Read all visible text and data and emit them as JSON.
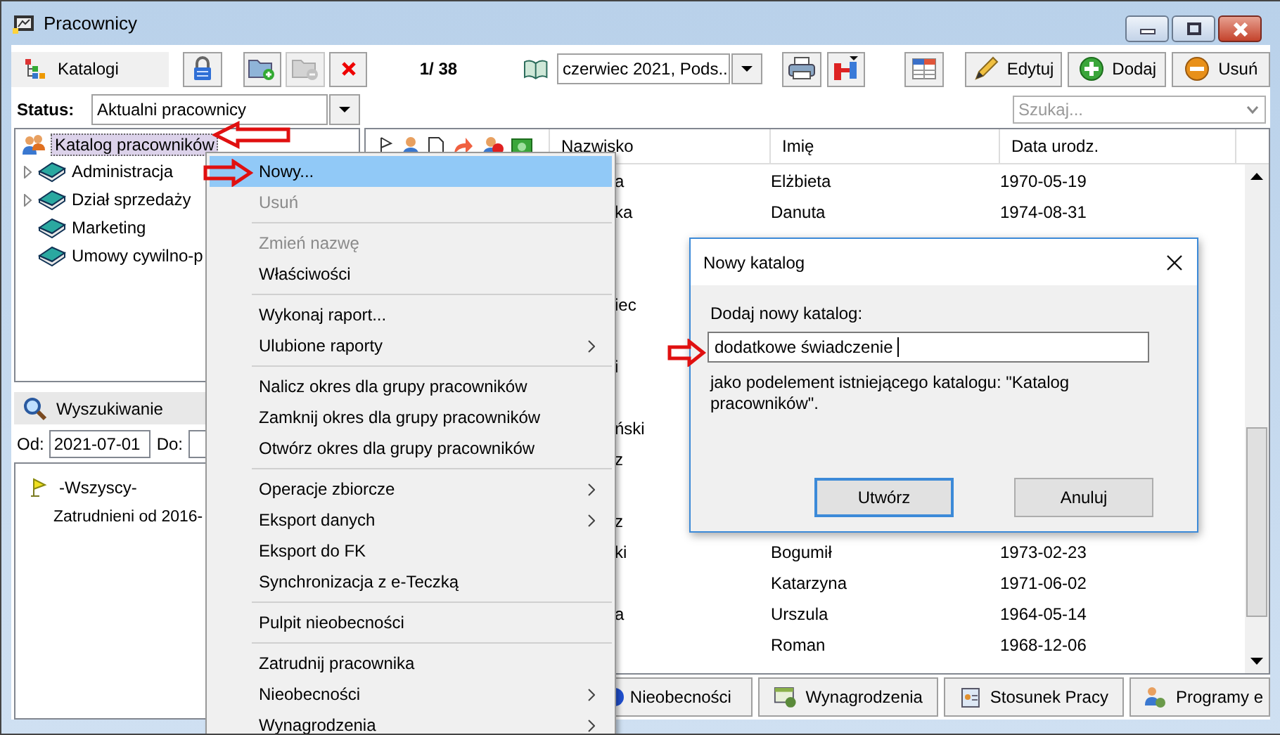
{
  "window": {
    "title": "Pracownicy"
  },
  "toolbar": {
    "catalogs_button": "Katalogi",
    "tool_buttons": [
      {
        "kind": "lock",
        "disabled": false
      },
      {
        "kind": "folder-add",
        "disabled": false
      },
      {
        "kind": "folder-remove",
        "disabled": true
      },
      {
        "kind": "delete",
        "disabled": false
      }
    ],
    "record_counter": "1/ 38",
    "period": "czerwiec 2021, Pods...",
    "actions": [
      {
        "label": "Edytuj",
        "kind": "edit"
      },
      {
        "label": "Dodaj",
        "kind": "add"
      },
      {
        "label": "Usuń",
        "kind": "remove"
      }
    ]
  },
  "status": {
    "label": "Status:",
    "value": "Aktualni pracownicy"
  },
  "search": {
    "placeholder": "Szukaj..."
  },
  "catalog_tree": {
    "root": {
      "label": "Katalog pracowników",
      "selected": true
    },
    "items": [
      {
        "label": "Administracja",
        "expandable": true
      },
      {
        "label": "Dział sprzedaży",
        "expandable": true
      },
      {
        "label": "Marketing",
        "expandable": false
      },
      {
        "label": "Umowy cywilno-p",
        "expandable": false
      }
    ]
  },
  "search_panel": {
    "title": "Wyszukiwanie",
    "from_label": "Od:",
    "from": "2021-07-01",
    "to_label": "Do:",
    "items": [
      {
        "label": "-Wszyscy-",
        "kind": "flag"
      },
      {
        "label": "Zatrudnieni od 2016-",
        "kind": "plain"
      }
    ]
  },
  "table": {
    "columns": [
      "Nazwisko",
      "Imię",
      "Data urodz."
    ],
    "rows": [
      {
        "surname": "a",
        "first_name": "Elżbieta",
        "birth_date": "1970-05-19"
      },
      {
        "surname": "ka",
        "first_name": "Danuta",
        "birth_date": "1974-08-31"
      },
      {},
      {},
      {
        "surname": "iec"
      },
      {},
      {
        "surname": "i"
      },
      {},
      {
        "surname": "ński"
      },
      {
        "surname": "z"
      },
      {},
      {
        "surname": "z"
      },
      {
        "surname": "ki",
        "first_name": "Bogumił",
        "birth_date": "1973-02-23"
      },
      {
        "first_name": "Katarzyna",
        "birth_date": "1971-06-02"
      },
      {
        "surname": "a",
        "first_name": "Urszula",
        "birth_date": "1964-05-14"
      },
      {
        "first_name": "Roman",
        "birth_date": "1968-12-06"
      }
    ]
  },
  "bottom_tabs": [
    {
      "label": "Nieobecności",
      "kind": "absence"
    },
    {
      "label": "Wynagrodzenia",
      "kind": "salary"
    },
    {
      "label": "Stosunek Pracy",
      "kind": "contract"
    },
    {
      "label": "Programy e",
      "kind": "people"
    }
  ],
  "context_menu": {
    "groups": [
      [
        {
          "label": "Nowy...",
          "selected": true,
          "disabled": false,
          "submenu": false
        },
        {
          "label": "Usuń",
          "selected": false,
          "disabled": true,
          "submenu": false
        }
      ],
      [
        {
          "label": "Zmień nazwę",
          "selected": false,
          "disabled": true,
          "submenu": false
        },
        {
          "label": "Właściwości",
          "selected": false,
          "disabled": false,
          "submenu": false
        }
      ],
      [
        {
          "label": "Wykonaj raport...",
          "selected": false,
          "disabled": false,
          "submenu": false
        },
        {
          "label": "Ulubione raporty",
          "selected": false,
          "disabled": false,
          "submenu": true
        }
      ],
      [
        {
          "label": "Nalicz okres dla grupy pracowników",
          "selected": false,
          "disabled": false,
          "submenu": false
        },
        {
          "label": "Zamknij okres dla grupy pracowników",
          "selected": false,
          "disabled": false,
          "submenu": false
        },
        {
          "label": "Otwórz okres dla grupy pracowników",
          "selected": false,
          "disabled": false,
          "submenu": false
        }
      ],
      [
        {
          "label": "Operacje zbiorcze",
          "selected": false,
          "disabled": false,
          "submenu": true
        },
        {
          "label": "Eksport danych",
          "selected": false,
          "disabled": false,
          "submenu": true
        },
        {
          "label": "Eksport do FK",
          "selected": false,
          "disabled": false,
          "submenu": false
        },
        {
          "label": "Synchronizacja z e-Teczką",
          "selected": false,
          "disabled": false,
          "submenu": false
        }
      ],
      [
        {
          "label": "Pulpit nieobecności",
          "selected": false,
          "disabled": false,
          "submenu": false
        }
      ],
      [
        {
          "label": "Zatrudnij pracownika",
          "selected": false,
          "disabled": false,
          "submenu": false
        },
        {
          "label": "Nieobecności",
          "selected": false,
          "disabled": false,
          "submenu": true
        },
        {
          "label": "Wynagrodzenia",
          "selected": false,
          "disabled": false,
          "submenu": true
        }
      ]
    ]
  },
  "dialog": {
    "title": "Nowy katalog",
    "prompt": "Dodaj nowy katalog:",
    "value": "dodatkowe świadczenie",
    "note": "jako podelement istniejącego katalogu: \"Katalog pracowników\".",
    "buttons": [
      "Utwórz",
      "Anuluj"
    ]
  }
}
